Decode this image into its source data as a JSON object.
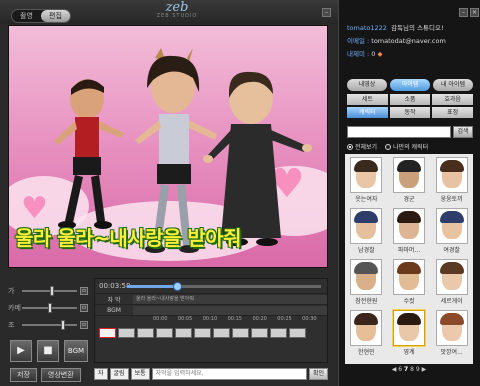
{
  "mode_tabs": [
    {
      "label": "촬영"
    },
    {
      "label": "편집"
    }
  ],
  "logo": {
    "mark": "zeb",
    "sub": "ZEB STUDIO"
  },
  "video": {
    "subtitle": "울라 울라~내사랑을 받아줘"
  },
  "controls": {
    "sliders": [
      {
        "label": "가",
        "level": 0.55
      },
      {
        "label": "카메",
        "level": 0.5
      },
      {
        "label": "조",
        "level": 0.75
      }
    ],
    "play_icon": "▶",
    "stop_icon": "■",
    "bgm_label": "BGM",
    "save_label": "저장",
    "export_label": "영상변환"
  },
  "timeline": {
    "time": "00:03:58",
    "progress": 0.26,
    "tracks": [
      {
        "name": "자 막",
        "content": "울라 울라~내사랑을 받아줘"
      },
      {
        "name": "BGM",
        "content": ""
      }
    ],
    "ruler": [
      "00:00",
      "00:05",
      "00:10",
      "00:15",
      "00:20",
      "00:25",
      "00:30"
    ]
  },
  "inputbar": {
    "type_value": "자",
    "font_value": "굴림",
    "style_value": "보통",
    "placeholder": "자막을 입력하세요.",
    "confirm_label": "확인"
  },
  "profile": {
    "user_id": "tomato1222",
    "greeting": "감독님의 스튜디오!",
    "email_label": "이메일 :",
    "email": "tomatodat@naver.com",
    "items_label": "내제미 :",
    "items_value": "0"
  },
  "right_tabs": [
    {
      "label": "내영상"
    },
    {
      "label": "아이템"
    },
    {
      "label": "내 아이템"
    }
  ],
  "sub_tabs": [
    {
      "label": "세트"
    },
    {
      "label": "소품"
    },
    {
      "label": "효과음"
    },
    {
      "label": "캐릭터"
    },
    {
      "label": "동작"
    },
    {
      "label": "표정"
    }
  ],
  "search": {
    "button": "검색"
  },
  "filters": [
    {
      "label": "전체보기"
    },
    {
      "label": "나만의 캐릭터"
    }
  ],
  "characters": [
    {
      "name": "웃는여자",
      "skin": "#e9c6a6",
      "hair": "#3a2a1e"
    },
    {
      "name": "경군",
      "skin": "#caa07a",
      "hair": "#222"
    },
    {
      "name": "웅웅토끼",
      "skin": "#e8c3a3",
      "hair": "#4a2e1c"
    },
    {
      "name": "남경찰",
      "skin": "#e6c09e",
      "hair": "#2f3d6a"
    },
    {
      "name": "파마머...",
      "skin": "#deb594",
      "hair": "#2a1a12"
    },
    {
      "name": "여경찰",
      "skin": "#e7c3a2",
      "hair": "#2f3d6a"
    },
    {
      "name": "참전현원",
      "skin": "#d9b089",
      "hair": "#555"
    },
    {
      "name": "수컷",
      "skin": "#e2bb97",
      "hair": "#6b3a1c"
    },
    {
      "name": "세르게이",
      "skin": "#e9c8ab",
      "hair": "#5a3a22"
    },
    {
      "name": "한현민",
      "skin": "#e6be98",
      "hair": "#3a261a"
    },
    {
      "name": "영계",
      "skin": "#e9c8aa",
      "hair": "#2b1a10"
    },
    {
      "name": "맛깡여...",
      "skin": "#ecc9ad",
      "hair": "#8a4a2a"
    }
  ],
  "pager": {
    "prev": "◀",
    "pages": [
      "6",
      "7",
      "8",
      "9"
    ],
    "next": "▶"
  },
  "icons": {
    "close": "close-icon",
    "minimize": "minimize-icon"
  }
}
